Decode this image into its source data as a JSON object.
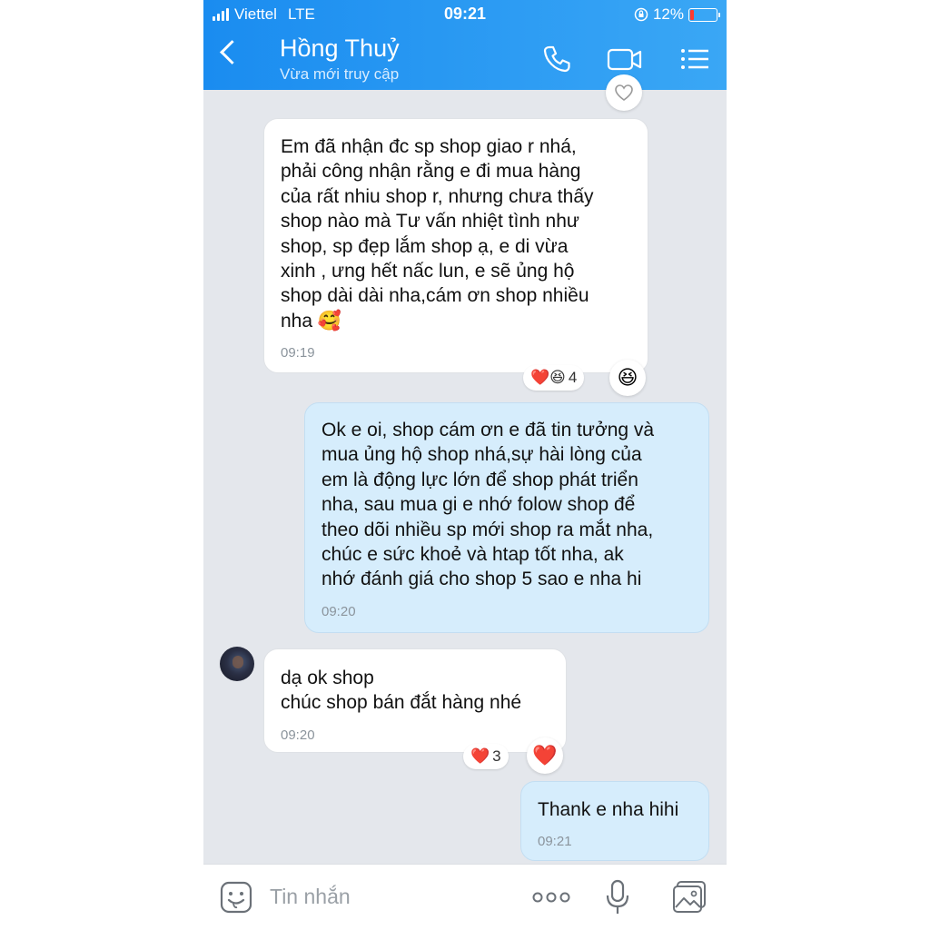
{
  "status_bar": {
    "carrier": "Viettel",
    "network": "LTE",
    "time": "09:21",
    "battery": "12%"
  },
  "header": {
    "contact_name": "Hồng Thuỷ",
    "contact_status": "Vừa mới truy cập",
    "icons": [
      "back-icon",
      "phone-icon",
      "video-call-icon",
      "menu-icon"
    ]
  },
  "colors": {
    "header_start": "#1a8cf0",
    "header_end": "#3aa7f5",
    "outgoing_bubble": "#d6edfc",
    "incoming_bubble": "#ffffff",
    "chat_background": "#e4e7ec"
  },
  "messages": [
    {
      "direction": "incoming",
      "text": "Em đã nhận đc sp shop giao r nhá,\nphải công nhận rằng e đi mua hàng\ncủa rất nhiu shop r, nhưng chưa thấy\nshop nào mà   Tư vấn nhiệt tình như\nshop, sp đẹp lắm shop ạ, e di vừa\nxinh , ưng hết nấc lun, e sẽ ủng hộ\nshop dài dài nha,cám ơn shop nhiều\nnha 🥰",
      "time": "09:19",
      "reaction_emojis": "❤️😆",
      "reaction_count": "4",
      "reaction_button": "😆"
    },
    {
      "direction": "outgoing",
      "text": "Ok e oi, shop cám ơn e đã tin tưởng và\nmua ủng hộ shop nhá,sự hài lòng của\nem là động lực lớn để shop phát triển\nnha, sau mua gi e nhớ folow shop để\ntheo dõi nhiều sp mới shop ra mắt nha,\nchúc e sức khoẻ và htap tốt nha, ak\nnhớ đánh giá cho shop 5 sao e nha hi",
      "time": "09:20"
    },
    {
      "direction": "incoming",
      "text": "dạ ok shop\nchúc shop bán đắt hàng nhé",
      "time": "09:20",
      "reaction_emojis": "❤️",
      "reaction_count": "3",
      "reaction_button": "❤️"
    },
    {
      "direction": "outgoing",
      "text": "Thank e nha hihi",
      "time": "09:21"
    }
  ],
  "input_bar": {
    "placeholder": "Tin nhắn",
    "icons": [
      "sticker-icon",
      "more-icon",
      "microphone-icon",
      "image-icon"
    ]
  }
}
